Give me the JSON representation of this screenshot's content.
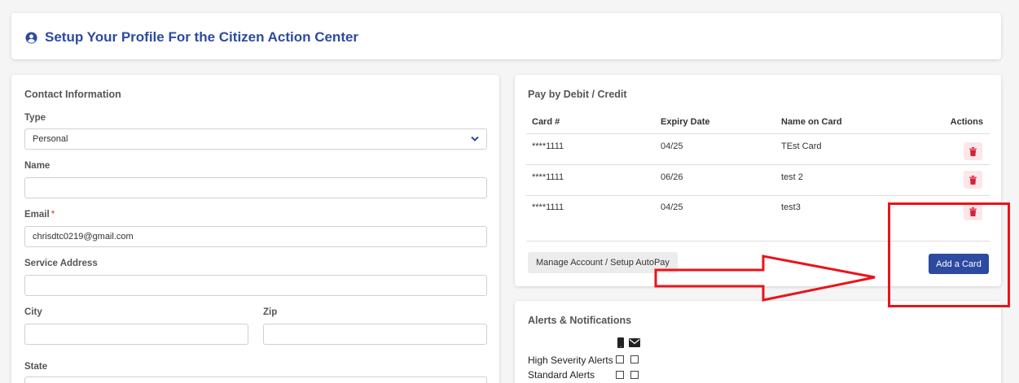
{
  "header": {
    "title": "Setup Your Profile For the Citizen Action Center",
    "icon": "user-circle-icon",
    "color": "#2d4aa1"
  },
  "contact": {
    "section_title": "Contact Information",
    "type_label": "Type",
    "type_value": "Personal",
    "name_label": "Name",
    "name_value": "",
    "email_label": "Email",
    "email_required": "*",
    "email_value": "chrisdtc0219@gmail.com",
    "service_address_label": "Service Address",
    "service_address_value": "",
    "city_label": "City",
    "city_value": "",
    "zip_label": "Zip",
    "zip_value": "",
    "state_label": "State"
  },
  "payment": {
    "section_title": "Pay by Debit / Credit",
    "columns": [
      "Card #",
      "Expiry Date",
      "Name on Card",
      "Actions"
    ],
    "cards": [
      {
        "number": "****1111",
        "expiry": "04/25",
        "name": "TEst Card"
      },
      {
        "number": "****1111",
        "expiry": "06/26",
        "name": "test 2"
      },
      {
        "number": "****1111",
        "expiry": "04/25",
        "name": "test3"
      }
    ],
    "manage_label": "Manage Account / Setup AutoPay",
    "add_label": "Add a Card",
    "accent": "#2d4aa1",
    "delete_color": "#d6203a"
  },
  "alerts": {
    "section_title": "Alerts & Notifications",
    "channel_icons": [
      "mobile-icon",
      "envelope-icon"
    ],
    "items": [
      {
        "label": "High Severity Alerts",
        "sms": false,
        "email": false
      },
      {
        "label": "Standard Alerts",
        "sms": false,
        "email": false
      }
    ]
  },
  "annotation": {
    "color": "#e8141b"
  }
}
